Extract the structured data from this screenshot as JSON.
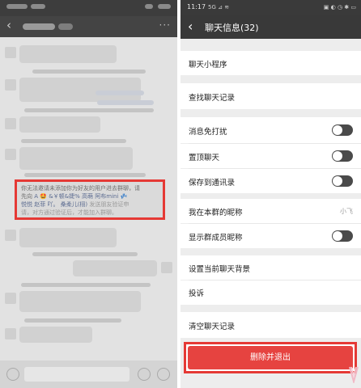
{
  "left_panel": {
    "system_message": {
      "line1": "你无法邀请未添加你为好友的用户进去群聊，请",
      "line2_prefix": "先向",
      "names_line2": [
        "A",
        "&￥顿&婕%",
        "高萌",
        "阿布mini"
      ],
      "names_line3": [
        "悦悦",
        "赵菲",
        "吖。",
        "桑柔儿(栩)"
      ],
      "line3_suffix": "发送朋友验证申",
      "line4": "请，对方通过验证后，才能加入群聊。"
    }
  },
  "right_panel": {
    "status": {
      "time": "11:17",
      "signal_text": "5G  ⊿  ≋",
      "icons_text": "▣ ◐ ◷ ✱ ▭"
    },
    "header": {
      "title": "聊天信息(32)"
    },
    "rows": {
      "mini_program": "聊天小程序",
      "find_history": "查找聊天记录",
      "mute": "消息免打扰",
      "pin": "置顶聊天",
      "save_contacts": "保存到通讯录",
      "my_nickname_label": "我在本群的昵称",
      "my_nickname_value": "小飞",
      "show_member_names": "显示群成员昵称",
      "set_background": "设置当前聊天背景",
      "complain": "投诉",
      "clear_history": "清空聊天记录"
    },
    "toggles": {
      "mute": false,
      "pin": false,
      "save_contacts": false,
      "show_member_names": false
    },
    "delete_button": "删除并退出"
  }
}
